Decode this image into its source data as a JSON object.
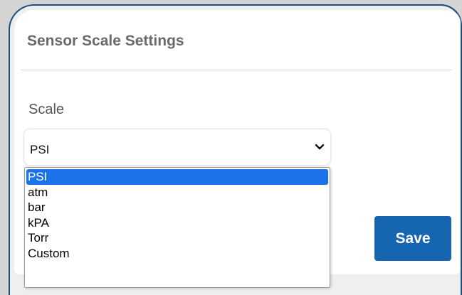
{
  "card": {
    "title": "Sensor Scale Settings"
  },
  "scale_field": {
    "label": "Scale",
    "selected_value": "PSI",
    "options": [
      "PSI",
      "atm",
      "bar",
      "kPA",
      "Torr",
      "Custom"
    ],
    "selected_index": 0
  },
  "actions": {
    "save_label": "Save"
  },
  "colors": {
    "accent": "#1565b0",
    "selection": "#1a73e8",
    "border": "#1d4f7d"
  },
  "icons": {
    "dropdown": "chevron-down-icon"
  }
}
